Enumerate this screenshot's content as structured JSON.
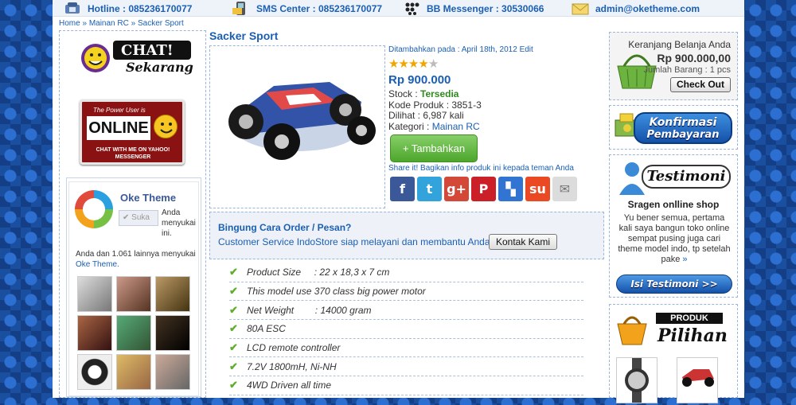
{
  "topbar": {
    "hotline": "Hotline : 085236170077",
    "sms": "SMS Center : 085236170077",
    "bbm": "BB Messenger : 30530066",
    "email": "admin@oketheme.com"
  },
  "breadcrumb": [
    "Home",
    "Mainan RC",
    "Sacker Sport"
  ],
  "left": {
    "yahoo_chat": "CHAT!",
    "yahoo_sub": "Sekarang",
    "online_top": "The Power User is",
    "online_word": "ONLINE",
    "online_bottom": "CHAT WITH ME ON YAHOO! MESSENGER",
    "fb_page": "Oke Theme",
    "fb_like_btn": "Suka",
    "fb_like_text": "Anda menyukai ini.",
    "fb_friends_text": "Anda dan 1.061 lainnya menyukai",
    "fb_friends_link": "Oke Theme."
  },
  "product": {
    "title": "Sacker Sport",
    "added": "Ditambahkan pada : April 18th, 2012",
    "edit": "Edit",
    "rating": 4.5,
    "price": "Rp 900.000",
    "stock_label": "Stock : ",
    "stock_value": "Tersedia",
    "code": "Kode Produk : 3851-3",
    "views": "Dilihat : 6,987 kali",
    "category_label": "Kategori : ",
    "category_value": "Mainan RC",
    "add_button": "+ Tambahkan",
    "share_text": "Share it! Bagikan info produk ini kepada teman Anda"
  },
  "share_icons": [
    {
      "name": "facebook-icon",
      "glyph": "f",
      "color": "#3b5998"
    },
    {
      "name": "twitter-icon",
      "glyph": "t",
      "color": "#33a3dc"
    },
    {
      "name": "googleplus-icon",
      "glyph": "g+",
      "color": "#d34836"
    },
    {
      "name": "pinterest-icon",
      "glyph": "P",
      "color": "#cb2027"
    },
    {
      "name": "delicious-icon",
      "glyph": "▚",
      "color": "#3274d1"
    },
    {
      "name": "stumbleupon-icon",
      "glyph": "su",
      "color": "#eb4924"
    },
    {
      "name": "email-icon",
      "glyph": "✉",
      "color": "#dcdcdc"
    }
  ],
  "order": {
    "title": "Bingung Cara Order / Pesan?",
    "text": "Customer Service IndoStore siap melayani dan membantu Anda.",
    "button": "Kontak Kami"
  },
  "features": [
    "Product Size     : 22 x 18,3 x 7 cm",
    "This model use 370 class big power motor",
    "Net Weight        : 14000 gram",
    "80A ESC",
    "LCD remote controller",
    "7.2V 1800mH, Ni-NH",
    "4WD Driven all time"
  ],
  "cart": {
    "title": "Keranjang Belanja Anda",
    "total": "Rp 900.000,00",
    "qty": "Jumlah Barang : 1 pcs",
    "checkout": "Check Out"
  },
  "konfirmasi": {
    "line1": "Konfirmasi",
    "line2": "Pembayaran"
  },
  "testimoni": {
    "banner": "Testimoni",
    "title": "Sragen onlline shop",
    "text": "Yu bener semua, pertama kali saya bangun toko online sempat pusing juga cari theme model indo, tp setelah pake",
    "more": "»",
    "button": "Isi Testimoni >>"
  },
  "pilihan": {
    "line1": "PRODUK",
    "line2": "Pilihan"
  },
  "colors": {
    "brand_blue": "#1a5fb4",
    "green": "#4da62c",
    "stars": "#f0a500"
  }
}
